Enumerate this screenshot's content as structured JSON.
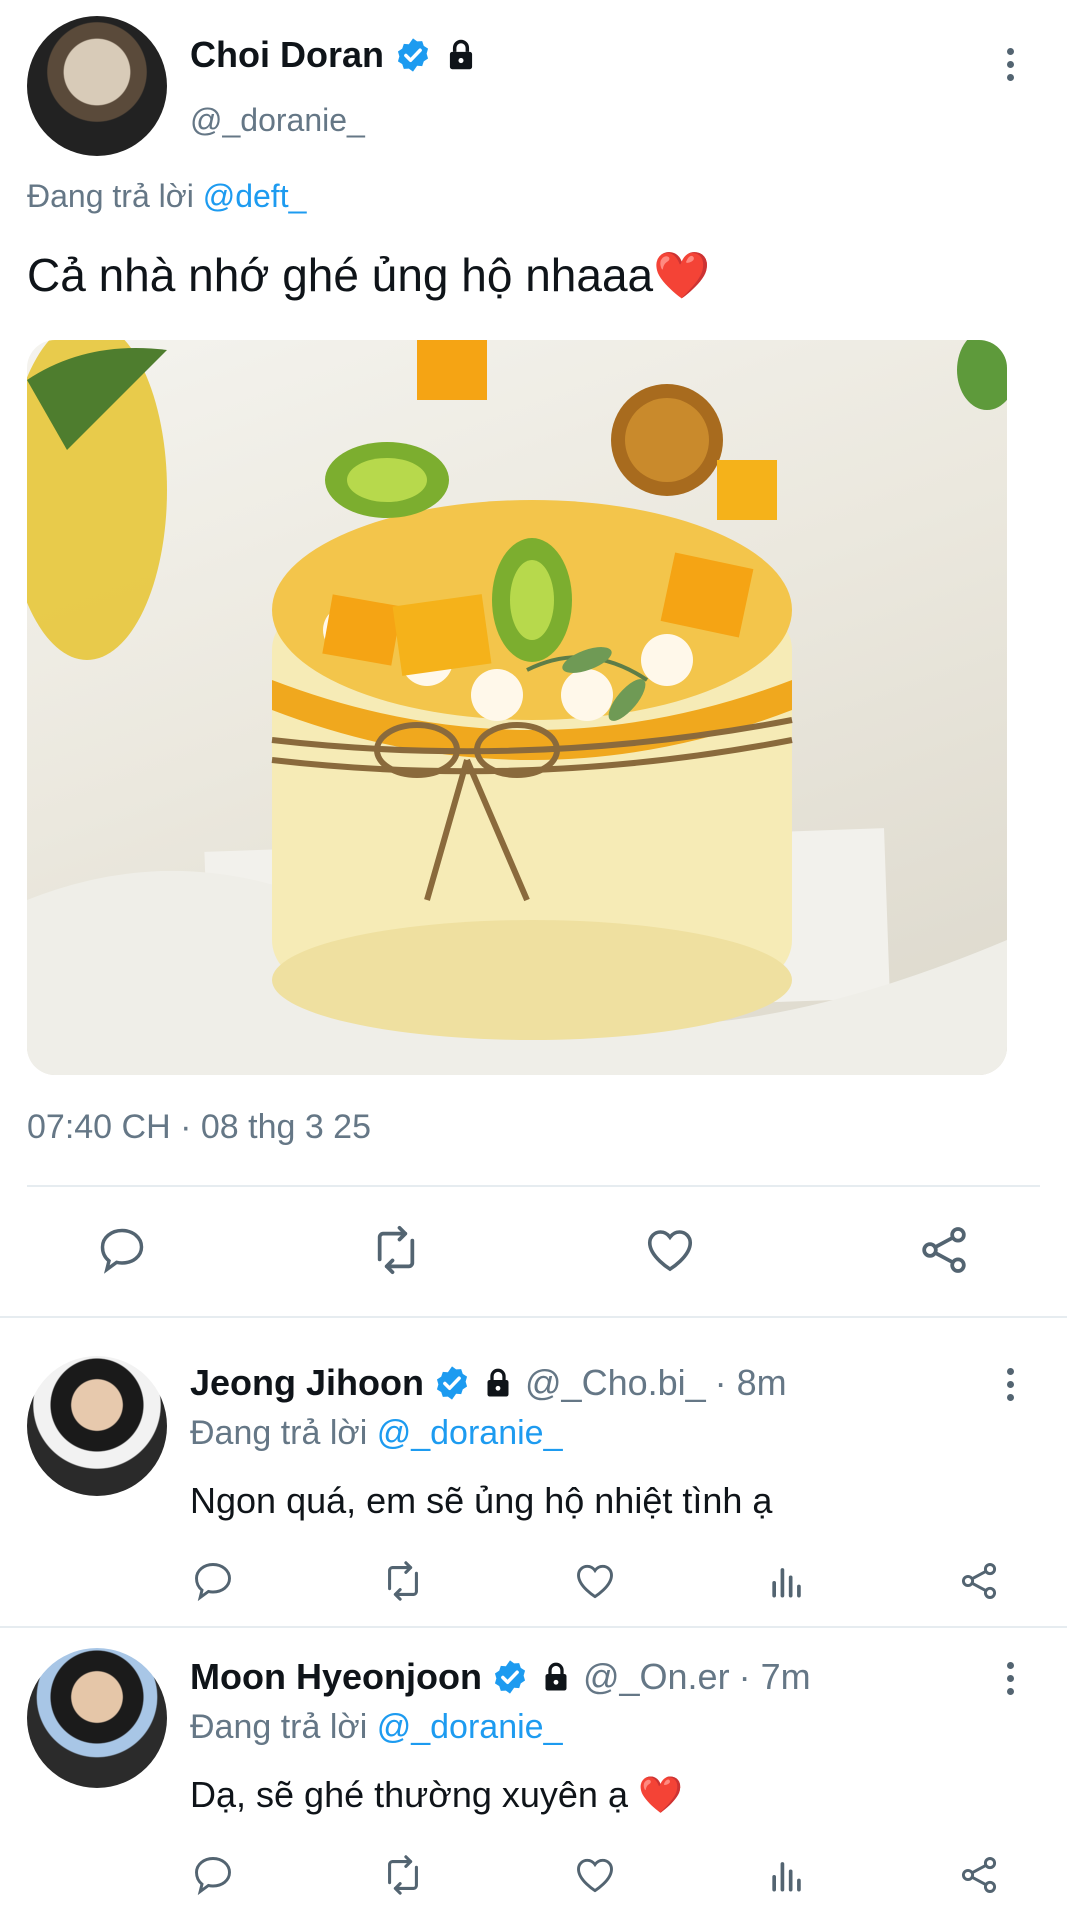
{
  "main_tweet": {
    "author_name": "Choi Doran",
    "author_handle": "@_doranie_",
    "reply_prefix": "Đang trả lời",
    "reply_to": "@deft_",
    "text": "Cả nhà nhớ ghé ủng hộ nhaaa",
    "emoji": "❤️",
    "timestamp": "07:40 CH · 08 thg 3 25"
  },
  "replies": [
    {
      "author_name": "Jeong Jihoon",
      "author_handle": "@_Cho.bi_",
      "time": "· 8m",
      "reply_prefix": "Đang trả lời",
      "reply_to": "@_doranie_",
      "text": "Ngon quá, em sẽ ủng hộ nhiệt tình ạ",
      "emoji": ""
    },
    {
      "author_name": "Moon Hyeonjoon",
      "author_handle": "@_On.er",
      "time": "· 7m",
      "reply_prefix": "Đang trả lời",
      "reply_to": "@_doranie_",
      "text": "Dạ, sẽ ghé thường xuyên ạ",
      "emoji": "❤️"
    }
  ],
  "icons": {
    "verified": "verified-badge-icon",
    "lock": "lock-icon",
    "more": "more-vertical-icon",
    "reply": "reply-icon",
    "retweet": "retweet-icon",
    "like": "heart-icon",
    "stats": "stats-icon",
    "share": "share-icon"
  },
  "colors": {
    "accent": "#1d9bf0",
    "secondary_text": "#657786",
    "divider": "#e6ecf0",
    "heart": "#e0245e"
  }
}
